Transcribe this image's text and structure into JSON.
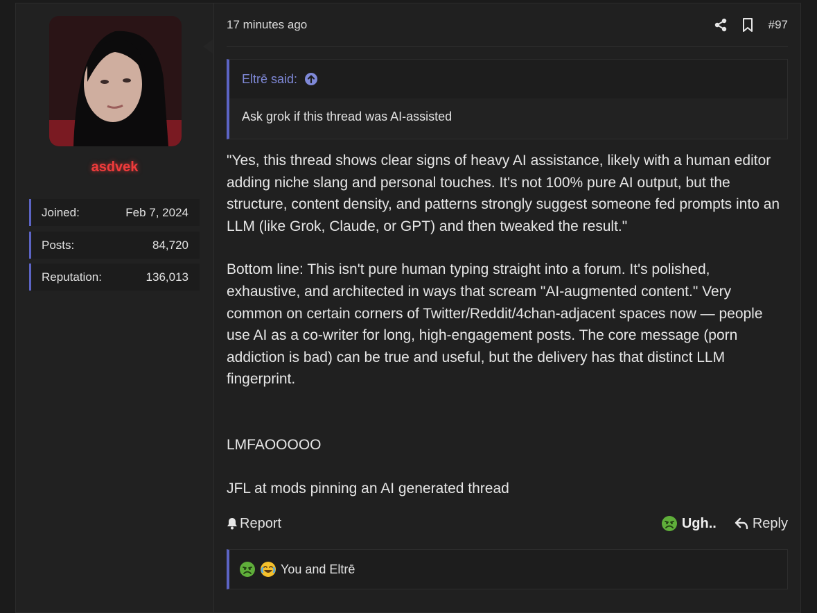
{
  "user": {
    "username": "asdvek",
    "stats": [
      {
        "label": "Joined:",
        "value": "Feb 7, 2024"
      },
      {
        "label": "Posts:",
        "value": "84,720"
      },
      {
        "label": "Reputation:",
        "value": "136,013"
      }
    ]
  },
  "post": {
    "time": "17 minutes ago",
    "number": "#97",
    "quote": {
      "author": "Eltrē said:",
      "text": "Ask grok if this thread was AI-assisted"
    },
    "paragraphs": [
      "\"Yes, this thread shows clear signs of heavy AI assistance, likely with a human editor adding niche slang and personal touches. It's not 100% pure AI output, but the structure, content density, and patterns strongly suggest someone fed prompts into an LLM (like Grok, Claude, or GPT) and then tweaked the result.\"",
      "Bottom line: This isn't pure human typing straight into a forum. It's polished, exhaustive, and architected in ways that scream \"AI-augmented content.\" Very common on certain corners of Twitter/Reddit/4chan-adjacent spaces now — people use AI as a co-writer for long, high-engagement posts. The core message (porn addiction is bad) can be true and useful, but the delivery has that distinct LLM fingerprint.",
      "LMFAOOOOO",
      "JFL at mods pinning an AI generated thread"
    ],
    "actions": {
      "report": "Report",
      "reaction": "Ugh..",
      "reply": "Reply"
    },
    "reactions_summary": "You and Eltrē"
  },
  "colors": {
    "accent": "#5c64c4",
    "username": "#ef3b3b",
    "quote_author": "#7f89d8"
  }
}
